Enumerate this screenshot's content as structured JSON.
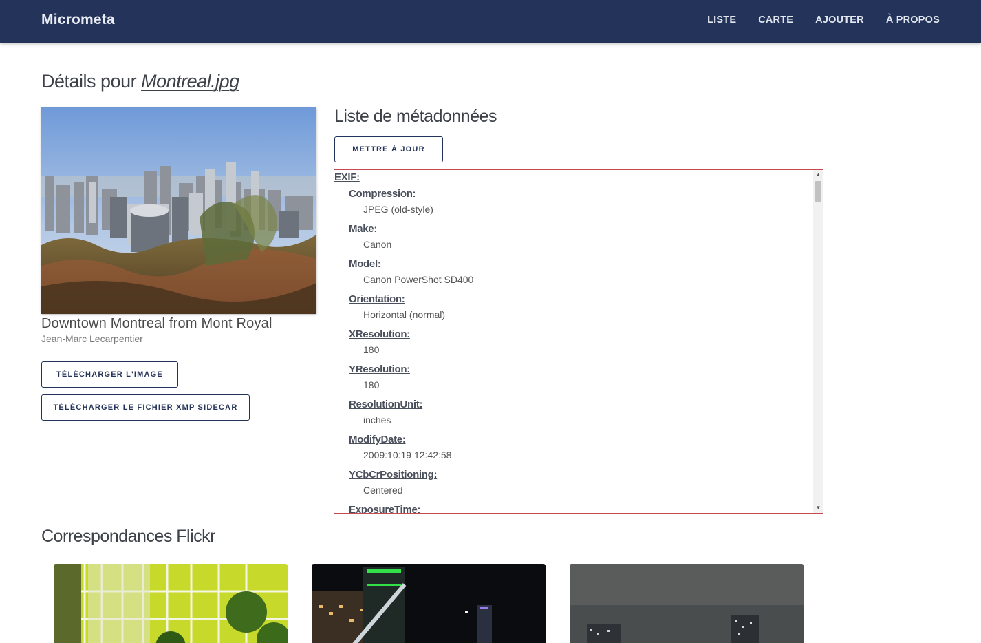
{
  "navbar": {
    "brand": "Micrometa",
    "links": [
      "LISTE",
      "CARTE",
      "AJOUTER",
      "À PROPOS"
    ]
  },
  "page": {
    "title_prefix": "Détails pour ",
    "filename": "Montreal.jpg"
  },
  "photo": {
    "caption": "Downtown Montreal from Mont Royal",
    "author": "Jean-Marc Lecarpentier"
  },
  "buttons": {
    "download_image": "TÉLÉCHARGER L'IMAGE",
    "download_xmp": "TÉLÉCHARGER LE FICHIER XMP SIDECAR",
    "update": "METTRE À JOUR"
  },
  "metadata": {
    "title": "Liste de métadonnées",
    "group": "EXIF:",
    "entries": [
      {
        "key": "Compression:",
        "value": "JPEG (old-style)"
      },
      {
        "key": "Make:",
        "value": "Canon"
      },
      {
        "key": "Model:",
        "value": "Canon PowerShot SD400"
      },
      {
        "key": "Orientation:",
        "value": "Horizontal (normal)"
      },
      {
        "key": "XResolution:",
        "value": "180"
      },
      {
        "key": "YResolution:",
        "value": "180"
      },
      {
        "key": "ResolutionUnit:",
        "value": "inches"
      },
      {
        "key": "ModifyDate:",
        "value": "2009:10:19 12:42:58"
      },
      {
        "key": "YCbCrPositioning:",
        "value": "Centered"
      },
      {
        "key": "ExposureTime:",
        "value": ""
      }
    ]
  },
  "flickr": {
    "title": "Correspondances Flickr"
  },
  "icons": {
    "scroll_up": "▲",
    "scroll_down": "▼"
  }
}
